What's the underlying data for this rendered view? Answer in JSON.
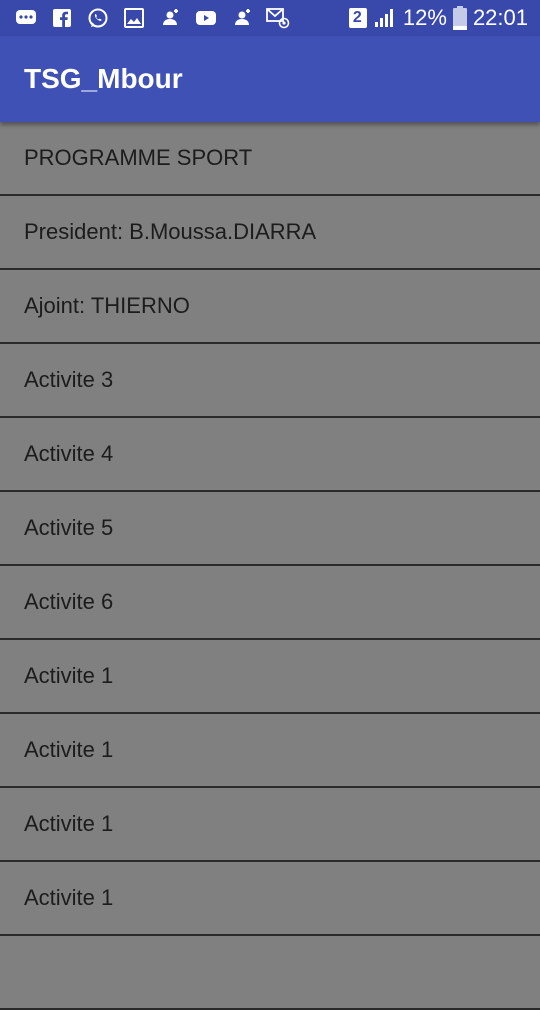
{
  "status_bar": {
    "left_icons": [
      "messenger-icon",
      "facebook-icon",
      "whatsapp-icon",
      "image-icon",
      "contact-icon",
      "youtube-icon",
      "contact-icon",
      "email-icon"
    ],
    "sim_badge": "2",
    "battery_percent": "12%",
    "time": "22:01"
  },
  "app_bar": {
    "title": "TSG_Mbour"
  },
  "list": {
    "items": [
      {
        "label": "PROGRAMME SPORT"
      },
      {
        "label": "President: B.Moussa.DIARRA"
      },
      {
        "label": "Ajoint: THIERNO"
      },
      {
        "label": "Activite 3"
      },
      {
        "label": "Activite 4"
      },
      {
        "label": "Activite 5"
      },
      {
        "label": "Activite 6"
      },
      {
        "label": "Activite 1"
      },
      {
        "label": "Activite 1"
      },
      {
        "label": "Activite 1"
      },
      {
        "label": "Activite 1"
      },
      {
        "label": ""
      }
    ]
  },
  "colors": {
    "status_bar": "#3949ab",
    "app_bar": "#3f51b5",
    "background": "#808080",
    "divider": "#2a2a2a",
    "text": "#1c1c1c"
  }
}
